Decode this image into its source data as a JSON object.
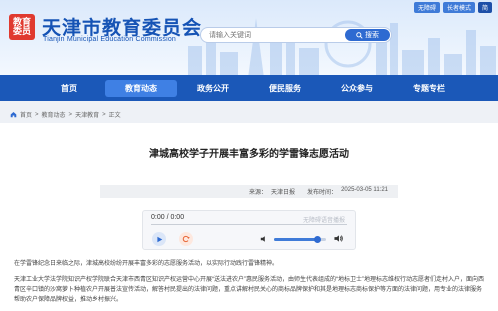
{
  "header": {
    "logo_text": "教育\n委员",
    "title_cn": "天津市教育委员会",
    "title_en": "Tianjin Municipal Education Commission",
    "top_links": [
      "无障碍",
      "长者模式",
      "简"
    ]
  },
  "search": {
    "placeholder": "请输入关键词",
    "button_label": "搜索"
  },
  "nav": {
    "items": [
      {
        "label": "首页"
      },
      {
        "label": "教育动态"
      },
      {
        "label": "政务公开"
      },
      {
        "label": "便民服务"
      },
      {
        "label": "公众参与"
      },
      {
        "label": "专题专栏"
      }
    ],
    "active_index": 1
  },
  "breadcrumb": {
    "items": [
      "首页",
      "教育动态",
      "天津教育",
      "正文"
    ],
    "separator": ">"
  },
  "article": {
    "title": "津城高校学子开展丰富多彩的学雷锋志愿活动",
    "source_label": "来源：",
    "source": "天津日报",
    "date_label": "发布时间：",
    "date": "2025-03-05 11:21",
    "paragraphs": [
      "在学雷锋纪念日来临之际，津城高校纷纷开展丰富多彩的志愿服务活动，以实际行动践行雷锋精神。",
      "天津工业大学法学院知识产权学院联合天津市西青区知识产权运营中心开展“送法进农户”惠民服务活动，由师生代表组成的“地标卫士”地理标志维权行动志愿者们走村入户，面向西青区辛口镇的沙窝萝卜种植农户开展普法宣传活动，解答村民提出的法律问题，重点讲解村民关心的商标品牌保护和其是地理标志商标保护等方面的法律问题，用专业的法律服务帮助农户保障品牌权益，推动乡村振兴。"
    ]
  },
  "player": {
    "time": "0:00 / 0:00",
    "brand": "无障碍语音播报",
    "volume": 0.82
  },
  "colors": {
    "nav_bg": "#1b58b8",
    "nav_active": "#3f80e4",
    "brand_blue": "#1553b5",
    "logo_red": "#e03a2f"
  }
}
